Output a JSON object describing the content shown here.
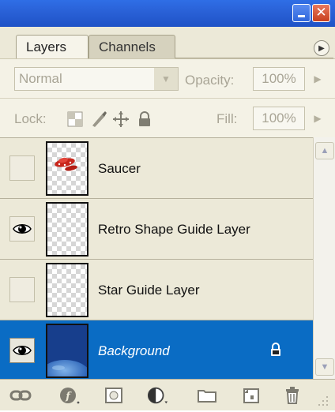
{
  "window": {
    "minimize_icon": "minimize-icon",
    "close_icon": "close-icon"
  },
  "tabs": [
    {
      "label": "Layers",
      "active": true
    },
    {
      "label": "Channels",
      "active": false
    }
  ],
  "blend_mode": {
    "value": "Normal"
  },
  "opacity": {
    "label": "Opacity:",
    "value": "100%"
  },
  "lock": {
    "label": "Lock:",
    "icons": [
      "lock-transparent-pixels-icon",
      "lock-image-pixels-icon",
      "lock-position-icon",
      "lock-all-icon"
    ]
  },
  "fill": {
    "label": "Fill:",
    "value": "100%"
  },
  "layers": [
    {
      "name": "Saucer",
      "visible": false,
      "selected": false,
      "locked": false,
      "thumbnail": "saucer-thumbnail"
    },
    {
      "name": "Retro Shape Guide Layer",
      "visible": true,
      "selected": false,
      "locked": false,
      "thumbnail": "transparent-thumbnail"
    },
    {
      "name": "Star Guide Layer",
      "visible": false,
      "selected": false,
      "locked": false,
      "thumbnail": "transparent-thumbnail"
    },
    {
      "name": "Background",
      "visible": true,
      "selected": true,
      "locked": true,
      "thumbnail": "space-planet-thumbnail"
    }
  ],
  "toolbar_icons": [
    "link-layers-icon",
    "layer-style-icon",
    "layer-mask-icon",
    "adjustment-layer-icon",
    "new-group-icon",
    "new-layer-icon",
    "delete-layer-icon"
  ],
  "colors": {
    "titlebar": "#2a62d8",
    "panel": "#ece9d8",
    "selection": "#0a6cc4"
  }
}
